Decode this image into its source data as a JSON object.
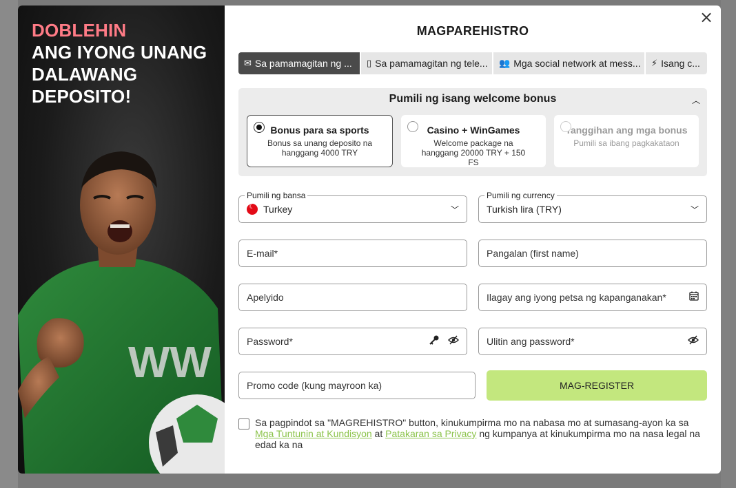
{
  "promo": {
    "headline_accent": "DOBLEHIN",
    "headline_rest": "ANG IYONG UNANG DALAWANG DEPOSITO!"
  },
  "modal": {
    "title": "MAGPAREHISTRO",
    "close_label": "×"
  },
  "tabs": [
    {
      "icon": "mail-icon",
      "glyph": "✉",
      "label": "Sa pamamagitan ng ...",
      "active": true
    },
    {
      "icon": "phone-icon",
      "glyph": "▯",
      "label": "Sa pamamagitan ng tele...",
      "active": false
    },
    {
      "icon": "users-icon",
      "glyph": "👥",
      "label": "Mga social network at mess...",
      "active": false
    },
    {
      "icon": "lightning-icon",
      "glyph": "⚡",
      "label": "Isang c...",
      "active": false
    }
  ],
  "bonus": {
    "heading": "Pumili ng isang welcome bonus",
    "options": [
      {
        "title": "Bonus para sa sports",
        "desc": "Bonus sa unang deposito na hanggang 4000 TRY",
        "selected": true
      },
      {
        "title": "Casino + WinGames",
        "desc": "Welcome package na hanggang 20000 TRY + 150 FS",
        "selected": false
      },
      {
        "title": "Tanggihan ang mga bonus",
        "desc": "Pumili sa ibang pagkakataon",
        "selected": false
      }
    ]
  },
  "form": {
    "country_label": "Pumili ng bansa",
    "country_value": "Turkey",
    "currency_label": "Pumili ng currency",
    "currency_value": "Turkish lira (TRY)",
    "email_placeholder": "E-mail*",
    "first_name_placeholder": "Pangalan (first name)",
    "last_name_placeholder": "Apelyido",
    "birthdate_placeholder": "Ilagay ang iyong petsa ng kapanganakan*",
    "password_placeholder": "Password*",
    "repeat_password_placeholder": "Ulitin ang password*",
    "promo_placeholder": "Promo code (kung mayroon ka)",
    "register_label": "MAG-REGISTER"
  },
  "terms": {
    "text_before": "Sa pagpindot sa \"MAGREHISTRO\" button, kinukumpirma mo na nabasa mo at sumasang-ayon ka sa ",
    "link_terms": "Mga Tuntunin at Kundisyon",
    "text_middle": " at ",
    "link_privacy": "Patakaran sa Privacy",
    "text_after": " ng kumpanya at kinukumpirma mo na nasa legal na edad ka na"
  },
  "colors": {
    "accent_green": "#c3e77e",
    "link_green": "#8bc34a",
    "headline_pink": "#ff7b86",
    "tab_active": "#4a4a4a"
  }
}
